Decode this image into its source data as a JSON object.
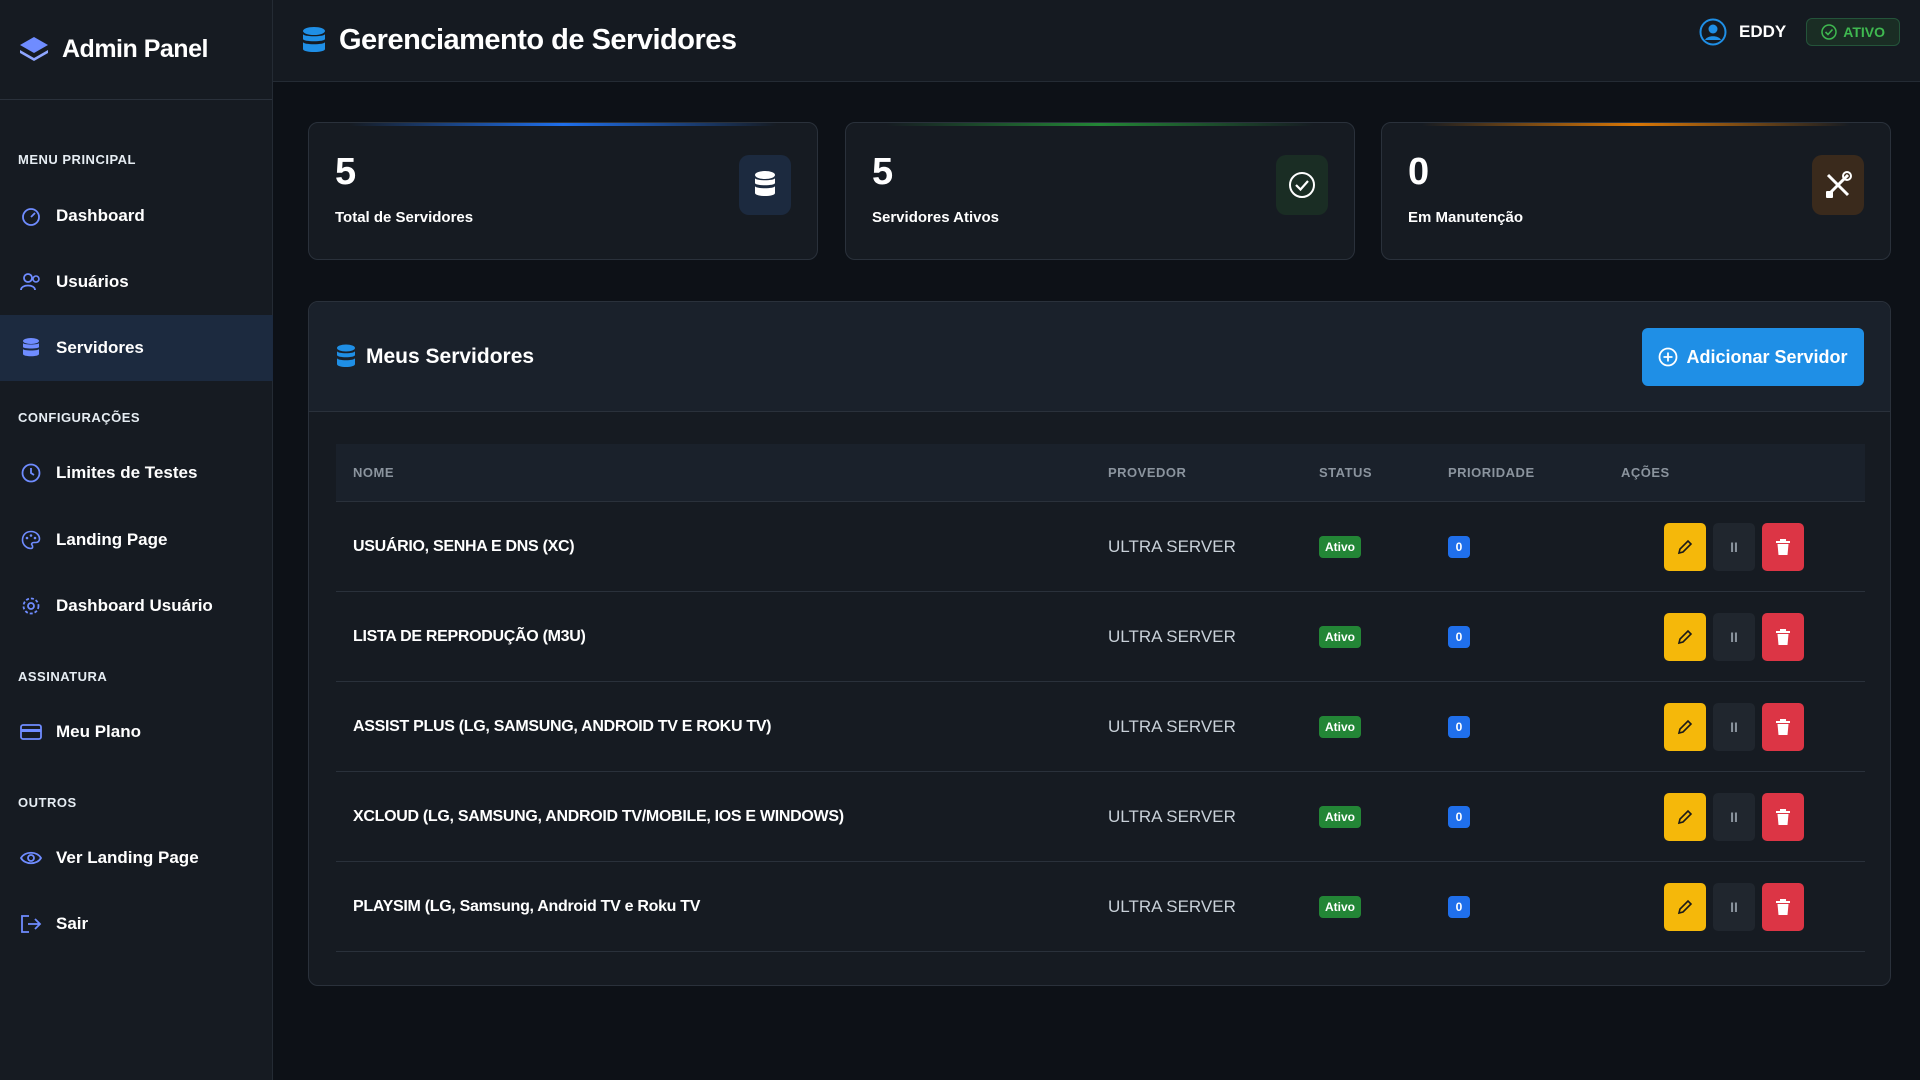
{
  "brand": {
    "title": "Admin Panel"
  },
  "sidebar": {
    "sections": [
      "MENU PRINCIPAL",
      "CONFIGURAÇÕES",
      "ASSINATURA",
      "OUTROS"
    ],
    "items": [
      {
        "label": "Dashboard",
        "icon": "gauge-icon"
      },
      {
        "label": "Usuários",
        "icon": "users-icon"
      },
      {
        "label": "Servidores",
        "icon": "database-icon",
        "active": true
      },
      {
        "label": "Limites de Testes",
        "icon": "clock-icon"
      },
      {
        "label": "Landing Page",
        "icon": "palette-icon"
      },
      {
        "label": "Dashboard Usuário",
        "icon": "gear-icon"
      },
      {
        "label": "Meu Plano",
        "icon": "credit-card-icon"
      },
      {
        "label": "Ver Landing Page",
        "icon": "eye-icon"
      },
      {
        "label": "Sair",
        "icon": "logout-icon"
      }
    ]
  },
  "header": {
    "title": "Gerenciamento de Servidores",
    "user_name": "EDDY",
    "status": "ATIVO"
  },
  "stats": [
    {
      "value": "5",
      "label": "Total de Servidores",
      "accent": "#1f6feb",
      "icon": "database-icon"
    },
    {
      "value": "5",
      "label": "Servidores Ativos",
      "accent": "#238636",
      "icon": "check-circle-icon"
    },
    {
      "value": "0",
      "label": "Em Manutenção",
      "accent": "#d97706",
      "icon": "tools-icon"
    }
  ],
  "panel": {
    "title": "Meus Servidores",
    "add_button": "Adicionar Servidor",
    "columns": [
      "NOME",
      "PROVEDOR",
      "STATUS",
      "PRIORIDADE",
      "AÇÕES"
    ],
    "rows": [
      {
        "name": "USUÁRIO, SENHA E DNS (XC)",
        "provider": "ULTRA SERVER",
        "status": "Ativo",
        "priority": "0"
      },
      {
        "name": "LISTA DE REPRODUÇÃO (M3U)",
        "provider": "ULTRA SERVER",
        "status": "Ativo",
        "priority": "0"
      },
      {
        "name": "ASSIST PLUS (LG, SAMSUNG, ANDROID TV E ROKU TV)",
        "provider": "ULTRA SERVER",
        "status": "Ativo",
        "priority": "0"
      },
      {
        "name": "XCLOUD (LG, SAMSUNG, ANDROID TV/MOBILE, IOS E WINDOWS)",
        "provider": "ULTRA SERVER",
        "status": "Ativo",
        "priority": "0"
      },
      {
        "name": "PLAYSIM (LG, Samsung, Android TV e Roku TV",
        "provider": "ULTRA SERVER",
        "status": "Ativo",
        "priority": "0"
      }
    ],
    "pause_glyph": "II"
  },
  "colors": {
    "accent_blue": "#1f8fe6",
    "success": "#238636",
    "warning": "#f5b80a",
    "danger": "#dc3545"
  }
}
